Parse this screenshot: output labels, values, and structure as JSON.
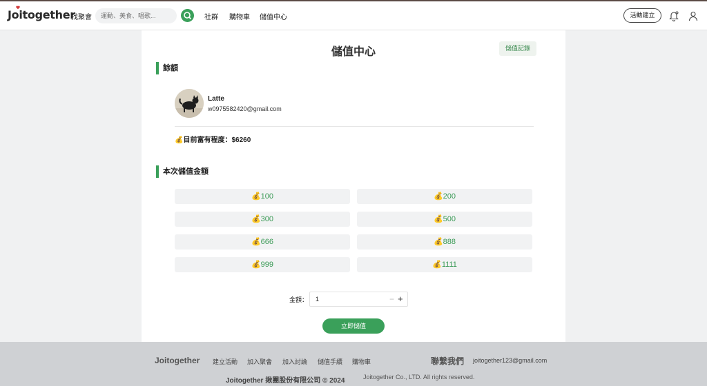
{
  "header": {
    "logo": "Joitogether",
    "find_label": "找聚會",
    "search_placeholder": "運動、美食、唱歌...",
    "nav_links": [
      "社群",
      "購物車",
      "儲值中心"
    ],
    "create_button": "活動建立"
  },
  "main": {
    "title": "儲值中心",
    "history_button": "儲值記錄",
    "balance_section_title": "餘額",
    "user": {
      "name": "Latte",
      "email": "w0975582420@gmail.com"
    },
    "balance_text": "💰目前富有程度：$6260",
    "topup_section_title": "本次儲值金額",
    "amounts": [
      "💰100",
      "💰200",
      "💰300",
      "💰500",
      "💰666",
      "💰888",
      "💰999",
      "💰1111"
    ],
    "amount_label": "金額：",
    "amount_value": "1",
    "submit_button": "立即儲值"
  },
  "footer": {
    "logo": "Joitogether",
    "links": [
      "建立活動",
      "加入聚會",
      "加入討論",
      "儲值手續",
      "購物車"
    ],
    "contact_title": "聯繫我們",
    "contact_email": "joitogether123@gmail.com",
    "company": "Joitogether 揪團股份有限公司 © 2024",
    "copyright": "Joitogether Co., LTD. All rights reserved."
  },
  "colors": {
    "accent_green": "#3aa05a",
    "footer_bg": "#cfd1d4",
    "page_bg": "#f0f1f2"
  },
  "icons": [
    "heart-logo-icon",
    "search-icon",
    "bell-icon",
    "user-icon",
    "money-bag-icon",
    "minus-icon",
    "plus-icon"
  ]
}
